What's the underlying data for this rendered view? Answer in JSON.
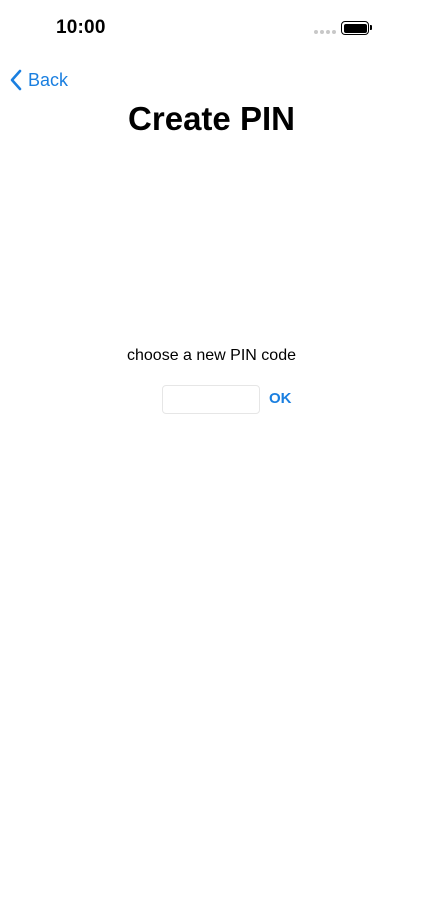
{
  "status_bar": {
    "time": "10:00",
    "signal_icon": "signal-dots-icon",
    "battery_icon": "battery-icon"
  },
  "nav": {
    "back_label": "Back",
    "back_icon": "chevron-left-icon"
  },
  "page": {
    "title": "Create PIN"
  },
  "pin_form": {
    "prompt": "choose a new PIN code",
    "input_value": "",
    "input_placeholder": "",
    "ok_label": "OK"
  },
  "colors": {
    "accent": "#1a7fe0",
    "background": "#ffffff",
    "text": "#000000"
  }
}
